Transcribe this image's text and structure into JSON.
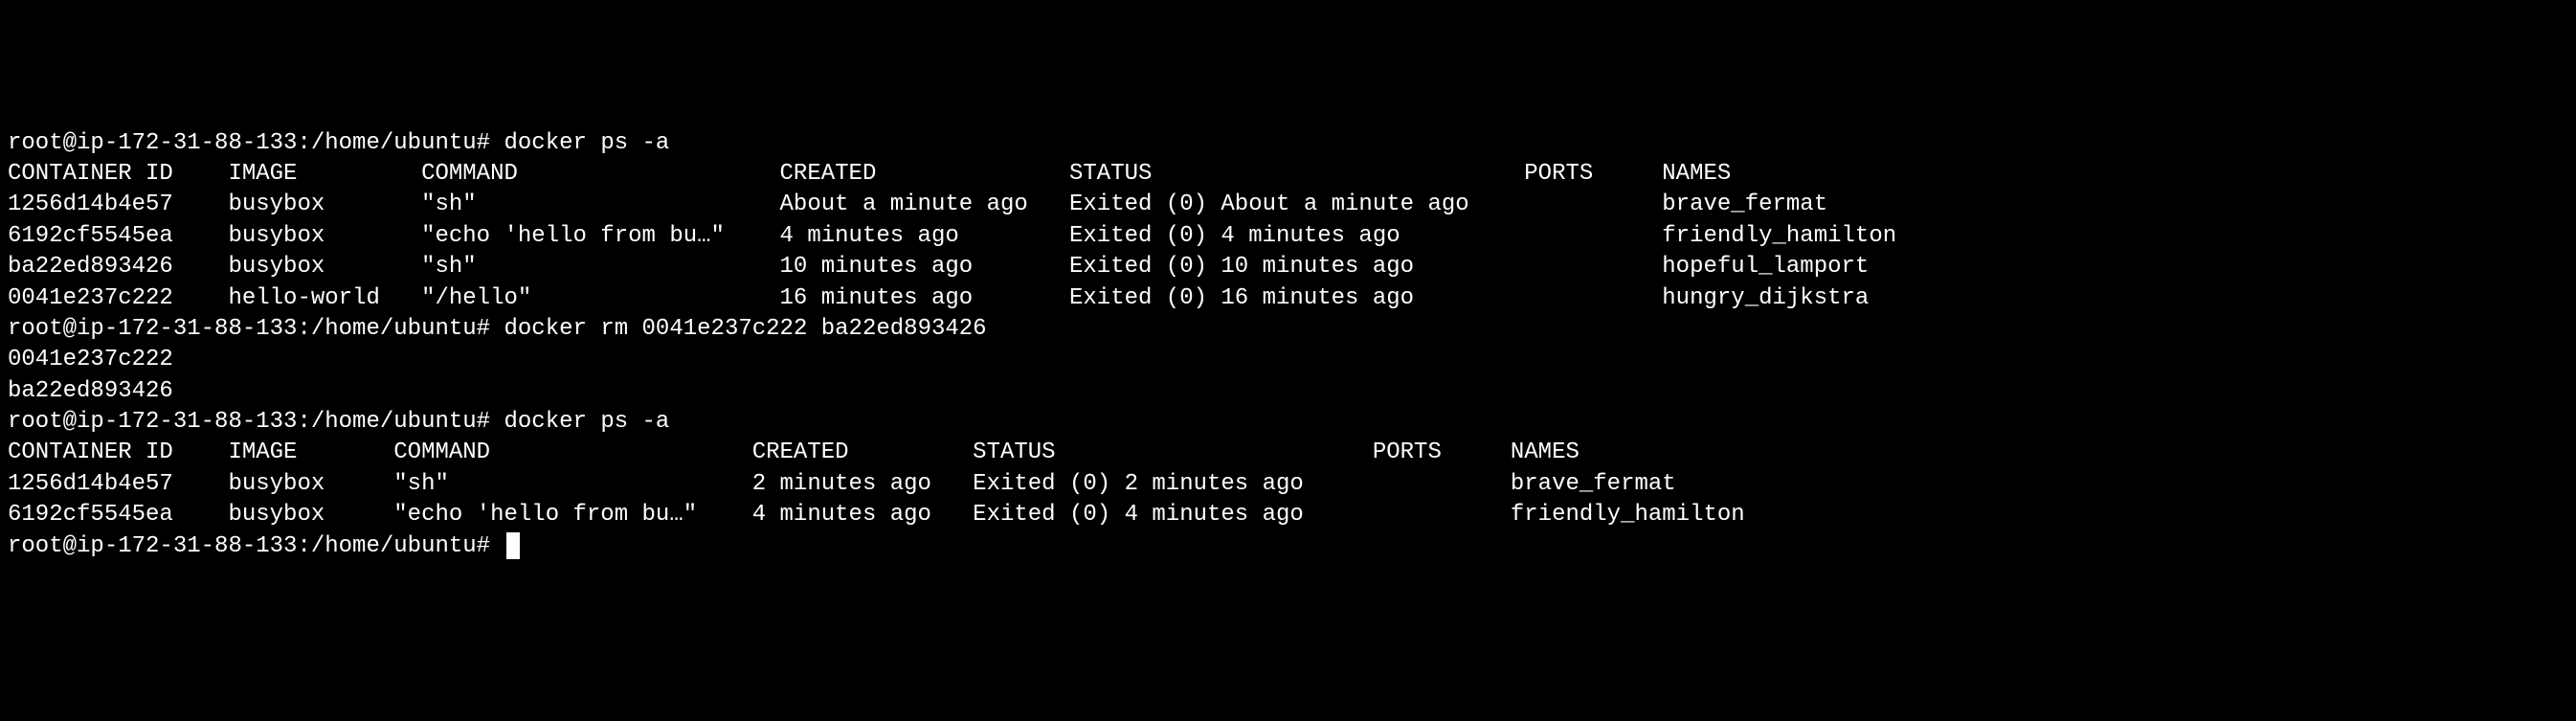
{
  "blocks": [
    {
      "prompt": "root@ip-172-31-88-133:/home/ubuntu#",
      "command": "docker ps -a",
      "table": {
        "headers": [
          "CONTAINER ID",
          "IMAGE",
          "COMMAND",
          "CREATED",
          "STATUS",
          "PORTS",
          "NAMES"
        ],
        "widths": [
          16,
          14,
          26,
          21,
          33,
          10,
          20
        ],
        "rows": [
          [
            "1256d14b4e57",
            "busybox",
            "\"sh\"",
            "About a minute ago",
            "Exited (0) About a minute ago",
            "",
            "brave_fermat"
          ],
          [
            "6192cf5545ea",
            "busybox",
            "\"echo 'hello from bu…\"",
            "4 minutes ago",
            "Exited (0) 4 minutes ago",
            "",
            "friendly_hamilton"
          ],
          [
            "ba22ed893426",
            "busybox",
            "\"sh\"",
            "10 minutes ago",
            "Exited (0) 10 minutes ago",
            "",
            "hopeful_lamport"
          ],
          [
            "0041e237c222",
            "hello-world",
            "\"/hello\"",
            "16 minutes ago",
            "Exited (0) 16 minutes ago",
            "",
            "hungry_dijkstra"
          ]
        ]
      }
    },
    {
      "prompt": "root@ip-172-31-88-133:/home/ubuntu#",
      "command": "docker rm 0041e237c222 ba22ed893426",
      "output_lines": [
        "0041e237c222",
        "ba22ed893426"
      ]
    },
    {
      "prompt": "root@ip-172-31-88-133:/home/ubuntu#",
      "command": "docker ps -a",
      "table": {
        "headers": [
          "CONTAINER ID",
          "IMAGE",
          "COMMAND",
          "CREATED",
          "STATUS",
          "PORTS",
          "NAMES"
        ],
        "widths": [
          16,
          12,
          26,
          16,
          29,
          10,
          20
        ],
        "rows": [
          [
            "1256d14b4e57",
            "busybox",
            "\"sh\"",
            "2 minutes ago",
            "Exited (0) 2 minutes ago",
            "",
            "brave_fermat"
          ],
          [
            "6192cf5545ea",
            "busybox",
            "\"echo 'hello from bu…\"",
            "4 minutes ago",
            "Exited (0) 4 minutes ago",
            "",
            "friendly_hamilton"
          ]
        ]
      }
    },
    {
      "prompt": "root@ip-172-31-88-133:/home/ubuntu#",
      "command": "",
      "cursor": true
    }
  ]
}
